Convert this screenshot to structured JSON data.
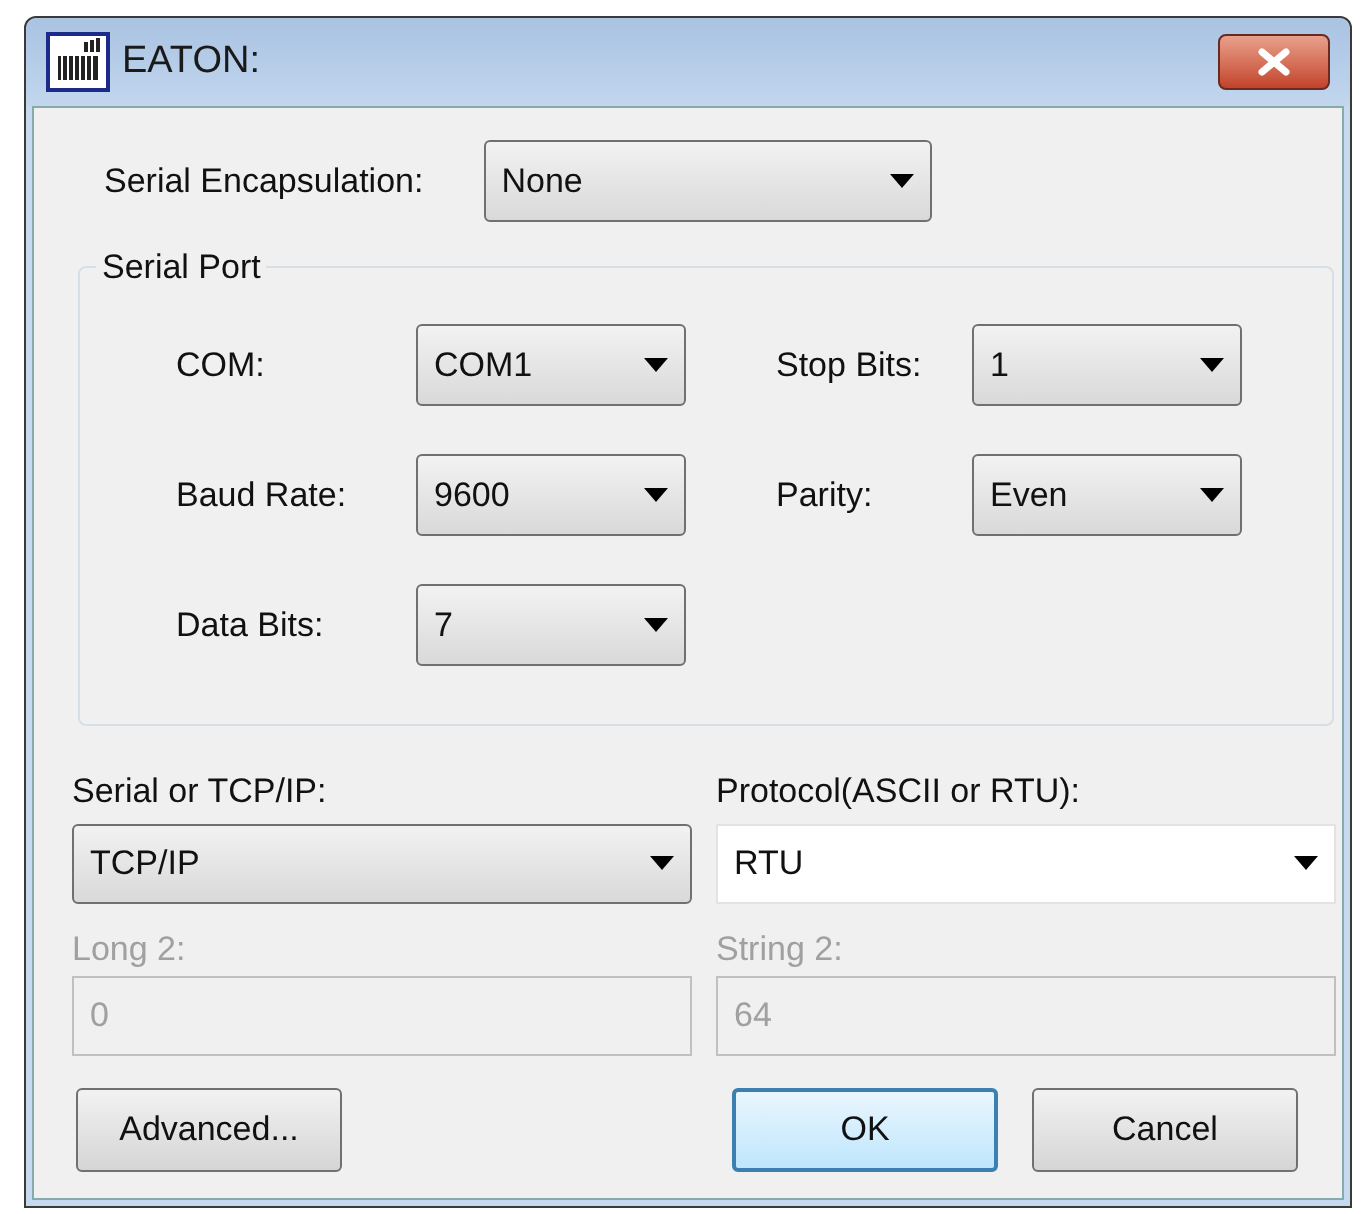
{
  "window": {
    "title": "EATON:"
  },
  "serial_encapsulation": {
    "label": "Serial Encapsulation:",
    "value": "None"
  },
  "serial_port": {
    "title": "Serial Port",
    "fields": [
      {
        "label": "COM:",
        "value": "COM1"
      },
      {
        "label": "Stop Bits:",
        "value": "1"
      },
      {
        "label": "Baud Rate:",
        "value": "9600"
      },
      {
        "label": "Parity:",
        "value": "Even"
      },
      {
        "label": "Data Bits:",
        "value": "7"
      }
    ]
  },
  "selectors": [
    {
      "label": "Serial or TCP/IP:",
      "value": "TCP/IP",
      "kind": "dropdown"
    },
    {
      "label": "Protocol(ASCII or RTU):",
      "value": "RTU",
      "kind": "combo"
    }
  ],
  "text_fields": [
    {
      "label": "Long 2:",
      "value": "0",
      "disabled": true
    },
    {
      "label": "String 2:",
      "value": "64",
      "disabled": true
    }
  ],
  "buttons": [
    {
      "label": "Advanced...",
      "default": false
    },
    {
      "label": "OK",
      "default": true
    },
    {
      "label": "Cancel",
      "default": false
    }
  ]
}
